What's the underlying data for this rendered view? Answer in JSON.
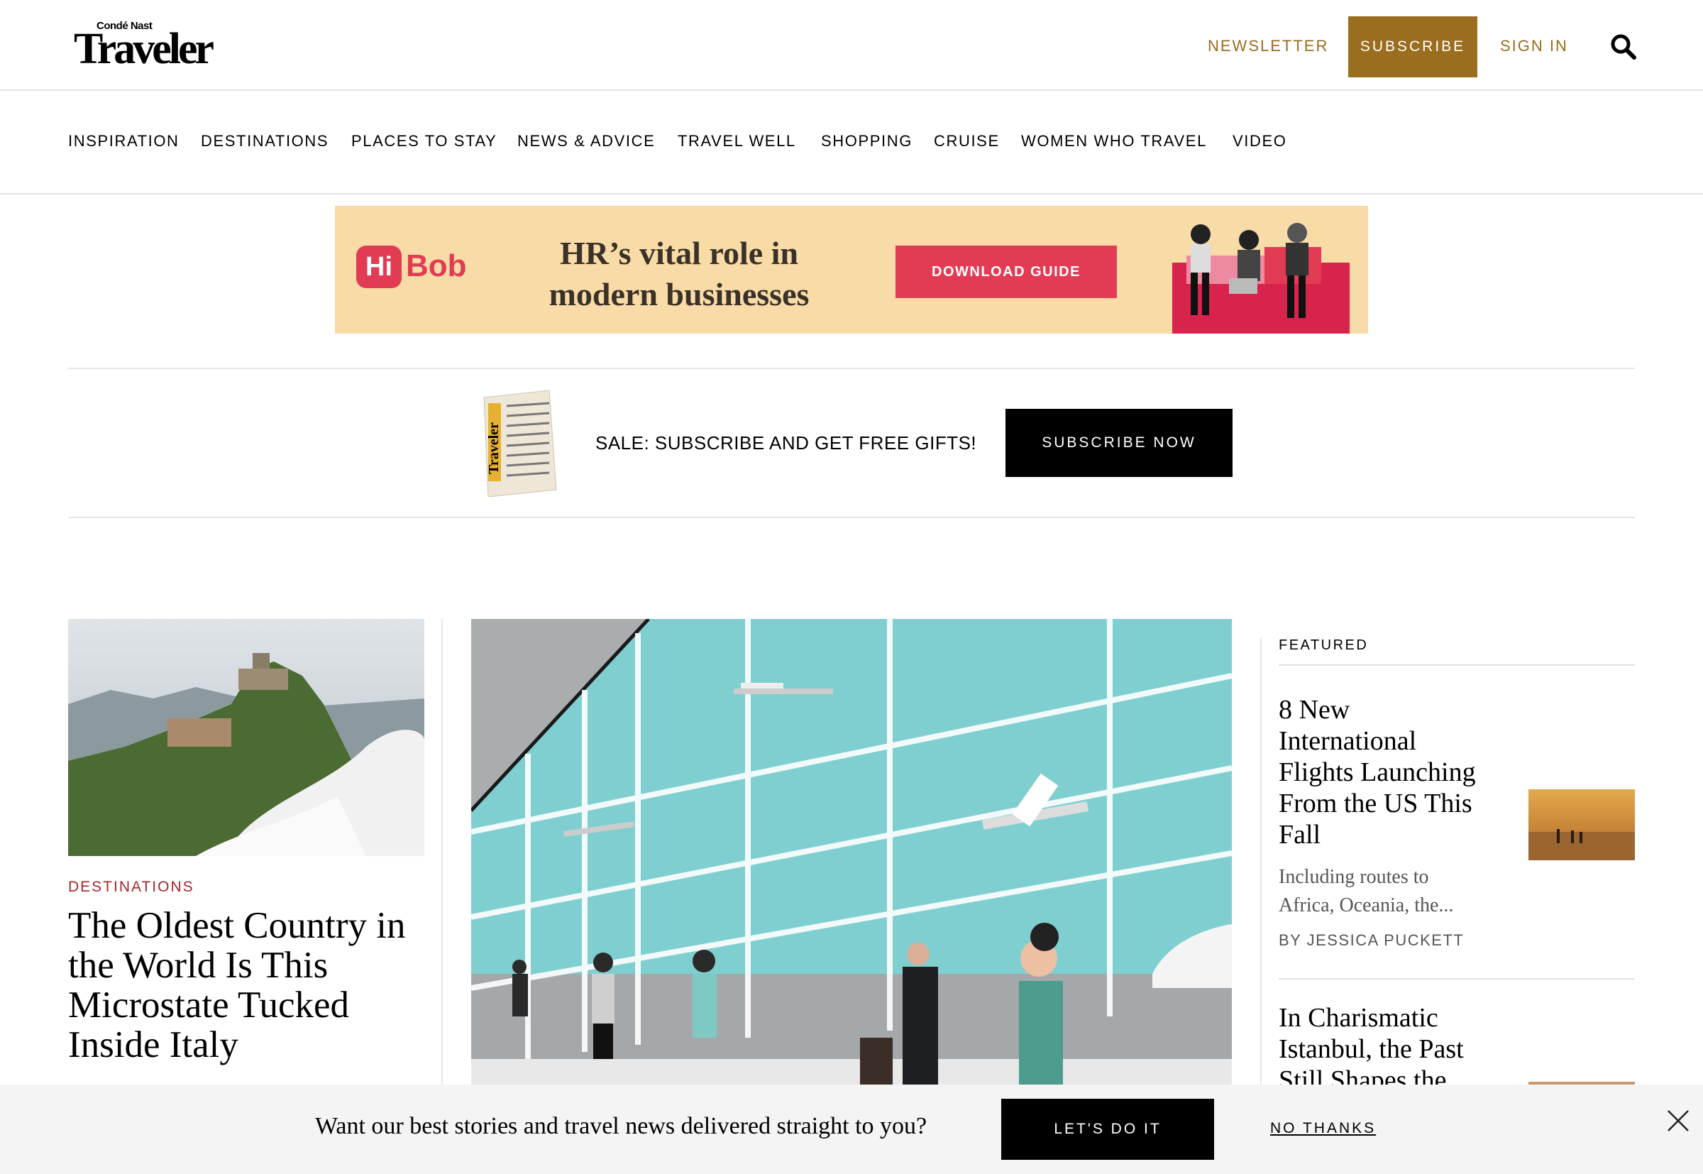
{
  "header": {
    "logo_small": "Condé Nast",
    "logo_big": "Traveler",
    "newsletter": "NEWSLETTER",
    "subscribe": "SUBSCRIBE",
    "sign_in": "SIGN IN"
  },
  "nav": {
    "items": [
      "INSPIRATION",
      "DESTINATIONS",
      "PLACES TO STAY",
      "NEWS & ADVICE",
      "TRAVEL WELL",
      "SHOPPING",
      "CRUISE",
      "WOMEN WHO TRAVEL",
      "VIDEO"
    ]
  },
  "ad": {
    "brand_hi": "Hi",
    "brand_bob": "Bob",
    "headline": "HR’s vital role in modern businesses",
    "cta": "DOWNLOAD GUIDE"
  },
  "promo": {
    "text": "SALE: SUBSCRIBE AND GET FREE GIFTS!",
    "button": "SUBSCRIBE NOW",
    "bag_brand": "Traveler"
  },
  "main_article": {
    "category": "DESTINATIONS",
    "title": "The Oldest Country in the World Is This Microstate Tucked Inside Italy"
  },
  "featured": {
    "label": "FEATURED",
    "cards": [
      {
        "title": "8 New International Flights Launching From the US This Fall",
        "dek": "Including routes to Africa, Oceania, the...",
        "byline": "BY JESSICA PUCKETT"
      },
      {
        "title": "In Charismatic Istanbul, the Past Still Shapes the"
      }
    ]
  },
  "newsletter_bar": {
    "text": "Want our best stories and travel news delivered straight to you?",
    "accept": "LET'S DO IT",
    "decline": "NO THANKS"
  },
  "colors": {
    "gold": "#9a6d1f",
    "category_red": "#a7252b",
    "ad_pink": "#e23b54",
    "ad_bg": "#f8dba6"
  }
}
